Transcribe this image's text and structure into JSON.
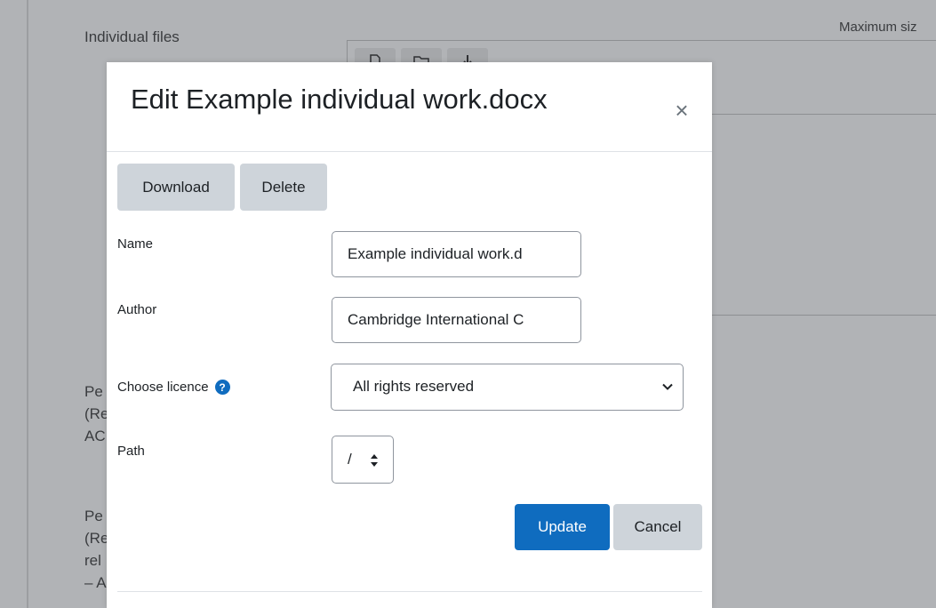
{
  "background": {
    "section_label": "Individual files",
    "max_size_label": "Maximum siz",
    "fragments_1": [
      "Pe",
      "(Re",
      "AC"
    ],
    "fragments_2": [
      "Pe",
      "(Re",
      "rel",
      "– A"
    ]
  },
  "modal": {
    "title": "Edit Example individual work.docx",
    "close_label": "×",
    "download_label": "Download",
    "delete_label": "Delete",
    "name_label": "Name",
    "name_value": "Example individual work.d",
    "author_label": "Author",
    "author_value": "Cambridge International C",
    "licence_label": "Choose licence",
    "licence_value": "All rights reserved",
    "path_label": "Path",
    "path_value": "/",
    "update_label": "Update",
    "cancel_label": "Cancel"
  },
  "colors": {
    "primary": "#0f6cbf",
    "secondary": "#ced4da",
    "overlay": "#b1b3b6"
  },
  "icons": {
    "close": "close-icon",
    "help": "question-circle-icon",
    "dropdown": "chevron-down-icon",
    "path": "sort-updown-icon"
  }
}
